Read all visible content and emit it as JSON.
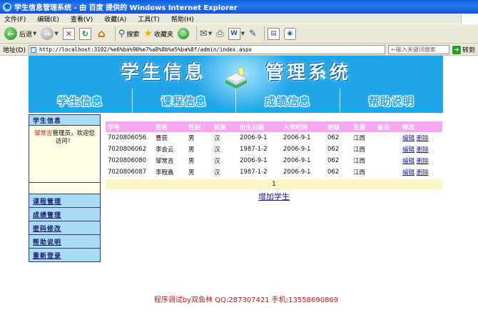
{
  "window": {
    "title": "学生信息管理系统 - 由 百度 提供的 Windows Internet Explorer"
  },
  "menu": [
    "文件(F)",
    "编辑(E)",
    "查看(V)",
    "收藏(A)",
    "工具(T)",
    "帮助(H)"
  ],
  "toolbar": {
    "back_label": "后退",
    "search_label": "搜索",
    "favorites_label": "收藏夹"
  },
  "address": {
    "label": "地址(D)",
    "url": "http://localhost:3102/%e6%ba%90%e7%a8%8b%e5%ba%8f/admin/index.aspx",
    "search_placeholder": "←输入关键词搜索",
    "go_label": "转到"
  },
  "banner": {
    "title_left": "学生信息",
    "title_right": "管理系统",
    "nav": [
      "学生信息",
      "课程信息",
      "成绩信息",
      "帮助说明"
    ]
  },
  "sidebar": {
    "header": "学生信息",
    "user_name": "邹常吉",
    "welcome": "管理员，欢迎您访问！",
    "links": [
      "课程管理",
      "成绩管理",
      "密码修改",
      "帮助说明",
      "重新登录"
    ]
  },
  "table": {
    "columns": [
      "学号",
      "姓名",
      "性别",
      "民族",
      "出生日期",
      "入学时间",
      "班级",
      "生源",
      "备注",
      "修改"
    ],
    "rows": [
      [
        "7020806056",
        "曹辰",
        "男",
        "汉",
        "2006-9-1",
        "2006-9-1",
        "062",
        "江西",
        "",
        ""
      ],
      [
        "7020806062",
        "李会云",
        "男",
        "汉",
        "1987-1-2",
        "2006-9-1",
        "062",
        "江西",
        "",
        ""
      ],
      [
        "7020806080",
        "邹常吉",
        "男",
        "汉",
        "2006-9-1",
        "2006-9-1",
        "062",
        "江西",
        "",
        ""
      ],
      [
        "7020806087",
        "李程鑫",
        "男",
        "汉",
        "1987-1-2",
        "2006-9-1",
        "062",
        "江西",
        "",
        ""
      ]
    ],
    "edit_label": "编辑",
    "delete_label": "删除",
    "pager": "1",
    "add_label": "增加学生"
  },
  "footer": "程序调试by双鱼林 QQ:287307421 手机:13558690869",
  "colors": {
    "banner": "#1fa5e8",
    "table_header": "#f7a8f0",
    "sidebar": "#a8dcf5",
    "footer_text": "#c81818"
  }
}
